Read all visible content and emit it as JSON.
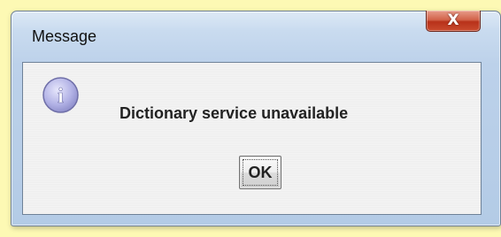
{
  "dialog": {
    "title": "Message",
    "close_icon": "close-icon",
    "close_glyph": "X",
    "message_icon": "info-icon",
    "info_icon_glyph": "i",
    "message": "Dictionary service unavailable",
    "ok_label": "OK"
  },
  "colors": {
    "background": "#fdf9b4",
    "frame": "#c9dbef",
    "close_button": "#c94b2e",
    "client": "#eeeeee",
    "info_icon": "#9f9fda"
  }
}
